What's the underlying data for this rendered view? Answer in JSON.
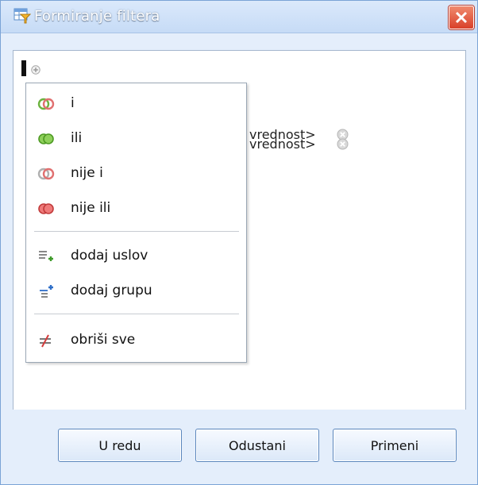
{
  "window": {
    "title": "Formiranje filtera",
    "title_icon": "filter-table-icon",
    "close_icon": "close-icon",
    "accent": "#d9402a",
    "border": "#7aa3d6"
  },
  "conditions": [
    {
      "value": "vrednost>",
      "remove_icon": "remove-circle-icon"
    },
    {
      "value": "vrednost>",
      "remove_icon": "remove-circle-icon"
    }
  ],
  "menu": {
    "items": [
      {
        "label": "i",
        "icon": "and-rings-icon"
      },
      {
        "label": "ili",
        "icon": "or-rings-icon"
      },
      {
        "label": "nije i",
        "icon": "not-and-rings-icon"
      },
      {
        "label": "nije ili",
        "icon": "not-or-rings-icon"
      },
      {
        "label": "dodaj uslov",
        "icon": "add-condition-icon"
      },
      {
        "label": "dodaj grupu",
        "icon": "add-group-icon"
      },
      {
        "label": "obriši sve",
        "icon": "clear-all-icon"
      }
    ]
  },
  "buttons": {
    "ok": "U redu",
    "cancel": "Odustani",
    "apply": "Primeni"
  }
}
